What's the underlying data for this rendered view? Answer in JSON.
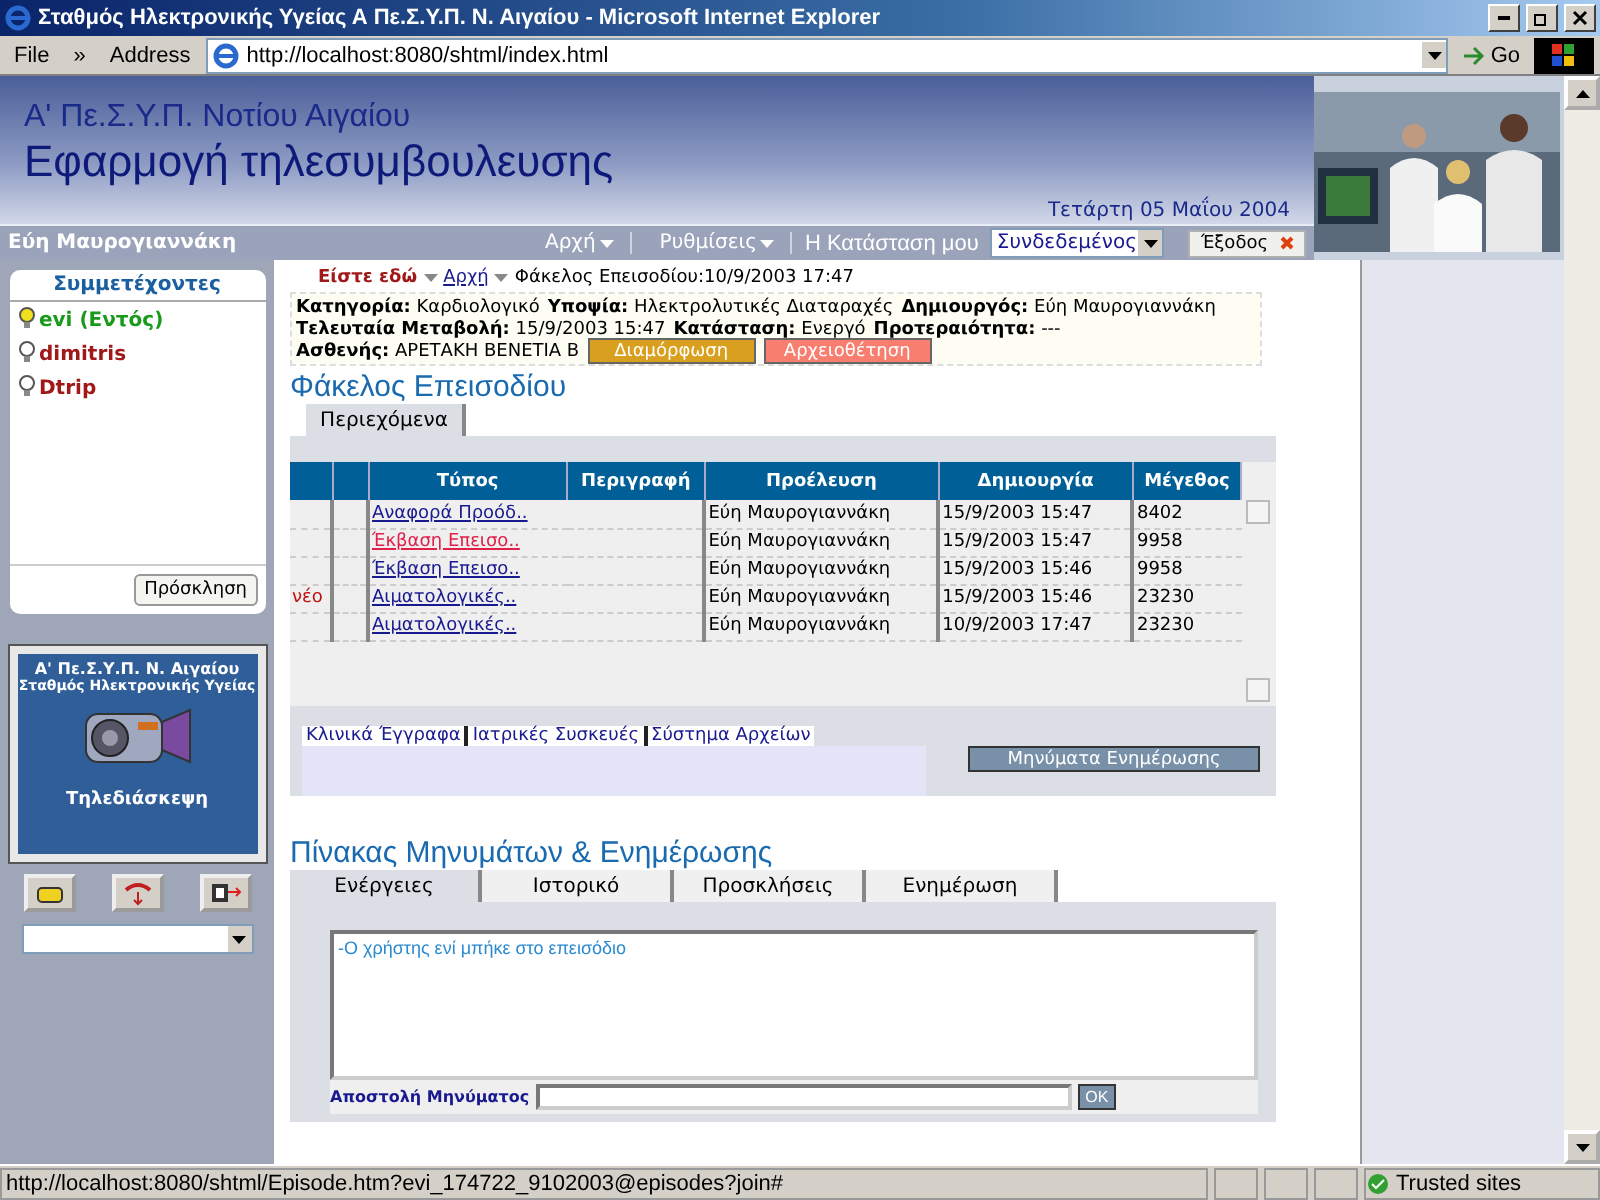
{
  "window": {
    "title": "Σταθμός Ηλεκτρονικής Υγείας Α Πε.Σ.Υ.Π. Ν. Αιγαίου - Microsoft Internet Explorer"
  },
  "toolbar": {
    "menu": "File",
    "chevron": "»",
    "address_label": "Address",
    "url": "http://localhost:8080/shtml/index.html",
    "go": "Go"
  },
  "header": {
    "org": "Α' Πε.Σ.Υ.Π. Νοτίου Αιγαίου",
    "app": "Εφαρμογή τηλεσυμβουλευσης",
    "date": "Τετάρτη 05 Μαΐου 2004"
  },
  "nav": {
    "user": "Εύη Μαυρογιαννάκη",
    "items": [
      "Αρχή",
      "Ρυθμίσεις"
    ],
    "status_label": "Η Κατάσταση μου",
    "status_value": "Συνδεδεμένος",
    "exit": "Έξοδος"
  },
  "participants": {
    "title": "Συμμετέχοντες",
    "items": [
      {
        "name": "evi (Εντός)",
        "online": true
      },
      {
        "name": "dimitris",
        "online": false
      },
      {
        "name": "Dtrip",
        "online": false
      }
    ],
    "invite": "Πρόσκληση"
  },
  "conference": {
    "org": "Α' Πε.Σ.Υ.Π. Ν. Αιγαίου",
    "station": "Σταθμός Ηλεκτρονικής Υγείας",
    "label": "Τηλεδιάσκεψη"
  },
  "breadcrumb": {
    "lead": "Είστε εδώ",
    "home": "Αρχή",
    "current": "Φάκελος Επεισοδίου:10/9/2003 17:47"
  },
  "info": [
    [
      {
        "label": "Κατηγορία:",
        "value": "Καρδιολογικό"
      },
      {
        "label": "Υποψία:",
        "value": "Ηλεκτρολυτικές Διαταραχές"
      },
      {
        "label": "Δημιουργός:",
        "value": "Εύη Μαυρογιαννάκη"
      }
    ],
    [
      {
        "label": "Τελευταία Μεταβολή:",
        "value": "15/9/2003 15:47"
      },
      {
        "label": "Κατάσταση:",
        "value": "Ενεργό"
      },
      {
        "label": "Προτεραιότητα:",
        "value": "---"
      }
    ],
    [
      {
        "label": "Ασθενής:",
        "value": "ΑΡΕΤΑΚΗ ΒΕΝΕΤΙΑ Β"
      }
    ]
  ],
  "actions": [
    {
      "label": "Διαμόρφωση",
      "color": "#d9a020"
    },
    {
      "label": "Αρχειοθέτηση",
      "color": "#f87f70"
    }
  ],
  "folder": {
    "title": "Φάκελος Επεισοδίου",
    "tabs": [
      {
        "label": "Περιεχόμενα",
        "selected": true
      }
    ],
    "columns": [
      "Τύπος",
      "Περιγραφή",
      "Προέλευση",
      "Δημιουργία",
      "Μέγεθος"
    ],
    "rows": [
      {
        "type": "Αναφορά Προόδ..",
        "highlighted": false,
        "origin": "Εύη Μαυρογιαννάκη",
        "created": "15/9/2003 15:47",
        "size": "8402"
      },
      {
        "type": "Έκβαση Επεισο..",
        "highlighted": true,
        "origin": "Εύη Μαυρογιαννάκη",
        "created": "15/9/2003 15:47",
        "size": "9958"
      },
      {
        "type": "Έκβαση Επεισο..",
        "highlighted": false,
        "origin": "Εύη Μαυρογιαννάκη",
        "created": "15/9/2003 15:46",
        "size": "9958"
      },
      {
        "flag": "νέο",
        "type": "Αιματολογικές..",
        "highlighted": false,
        "origin": "Εύη Μαυρογιαννάκη",
        "created": "15/9/2003 15:46",
        "size": "23230"
      },
      {
        "type": "Αιματολογικές..",
        "highlighted": false,
        "origin": "Εύη Μαυρογιαννάκη",
        "created": "10/9/2003 17:47",
        "size": "23230"
      }
    ],
    "links": [
      "Κλινικά Έγγραφα",
      "Ιατρικές Συσκευές",
      "Σύστημα Αρχείων"
    ],
    "messages_button": "Μηνύματα Ενημέρωσης"
  },
  "messages": {
    "title": "Πίνακας Μηνυμάτων & Ενημέρωσης",
    "tabs": [
      {
        "label": "Ενέργειες",
        "selected": true
      },
      {
        "label": "Ιστορικό",
        "selected": false
      },
      {
        "label": "Προσκλήσεις",
        "selected": false
      },
      {
        "label": "Ενημέρωση",
        "selected": false
      }
    ],
    "log": [
      "-Ο χρήστης ενί μπήκε στο επεισόδιο"
    ],
    "send_label": "Αποστολή Μηνύματος",
    "ok": "OK"
  },
  "status_bar": {
    "url": "http://localhost:8080/shtml/Episode.htm?evi_174722_9102003@episodes?join#",
    "zone": "Trusted sites"
  }
}
